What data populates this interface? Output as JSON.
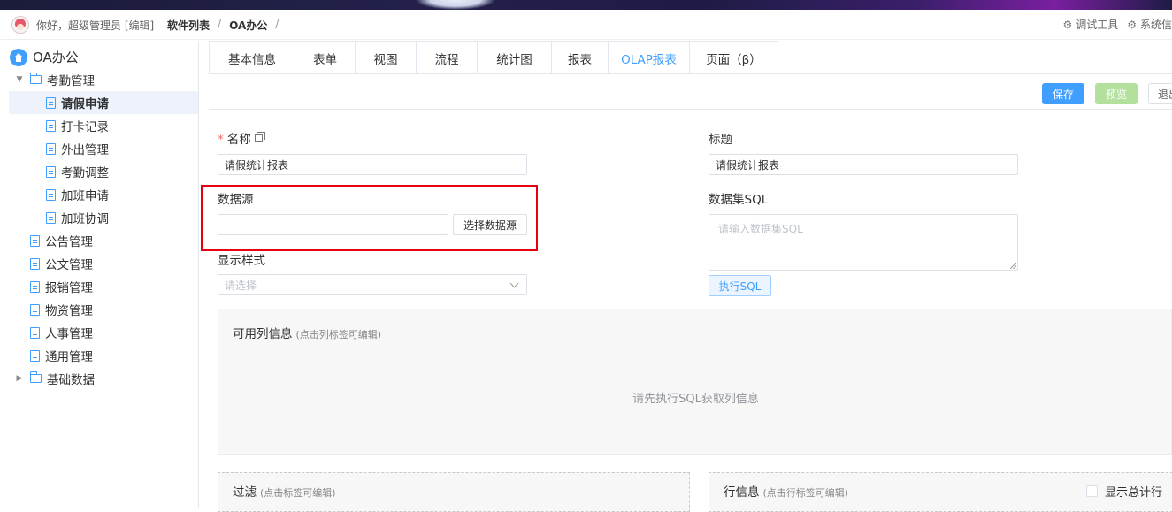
{
  "header": {
    "greeting": "你好，超级管理员 [编辑]",
    "breadcrumb": [
      "软件列表",
      "OA办公"
    ],
    "breadcrumb_sep": "/",
    "tools": [
      "调试工具",
      "系统信"
    ]
  },
  "sidebar": {
    "root": "OA办公",
    "items": [
      {
        "label": "考勤管理",
        "type": "folder",
        "expanded": true
      },
      {
        "label": "请假申请",
        "type": "doc",
        "selected": true
      },
      {
        "label": "打卡记录",
        "type": "doc"
      },
      {
        "label": "外出管理",
        "type": "doc"
      },
      {
        "label": "考勤调整",
        "type": "doc"
      },
      {
        "label": "加班申请",
        "type": "doc"
      },
      {
        "label": "加班协调",
        "type": "doc"
      },
      {
        "label": "公告管理",
        "type": "doc"
      },
      {
        "label": "公文管理",
        "type": "doc"
      },
      {
        "label": "报销管理",
        "type": "doc"
      },
      {
        "label": "物资管理",
        "type": "doc"
      },
      {
        "label": "人事管理",
        "type": "doc"
      },
      {
        "label": "通用管理",
        "type": "doc"
      },
      {
        "label": "基础数据",
        "type": "folder",
        "expanded": false
      }
    ]
  },
  "tabs": [
    "基本信息",
    "表单",
    "视图",
    "流程",
    "统计图",
    "报表",
    "OLAP报表",
    "页面（β）"
  ],
  "active_tab": "OLAP报表",
  "toolbar": {
    "save": "保存",
    "preview": "预览",
    "exit": "退出"
  },
  "form": {
    "name_label": "名称",
    "name_value": "请假统计报表",
    "title_label": "标题",
    "title_value": "请假统计报表",
    "datasource_label": "数据源",
    "datasource_value": "",
    "select_datasource": "选择数据源",
    "dataset_sql_label": "数据集SQL",
    "dataset_sql_placeholder": "请输入数据集SQL",
    "run_sql": "执行SQL",
    "display_style_label": "显示样式",
    "display_style_placeholder": "请选择"
  },
  "columns_panel": {
    "title": "可用列信息",
    "hint": "(点击列标签可编辑)",
    "empty": "请先执行SQL获取列信息"
  },
  "filter_panel": {
    "title": "过滤",
    "hint": "(点击标签可编辑)"
  },
  "row_panel": {
    "title": "行信息",
    "hint": "(点击行标签可编辑)",
    "show_total": "显示总计行"
  },
  "colors": {
    "accent": "#409eff",
    "highlight": "#e60012",
    "preview": "#b3e19d"
  }
}
